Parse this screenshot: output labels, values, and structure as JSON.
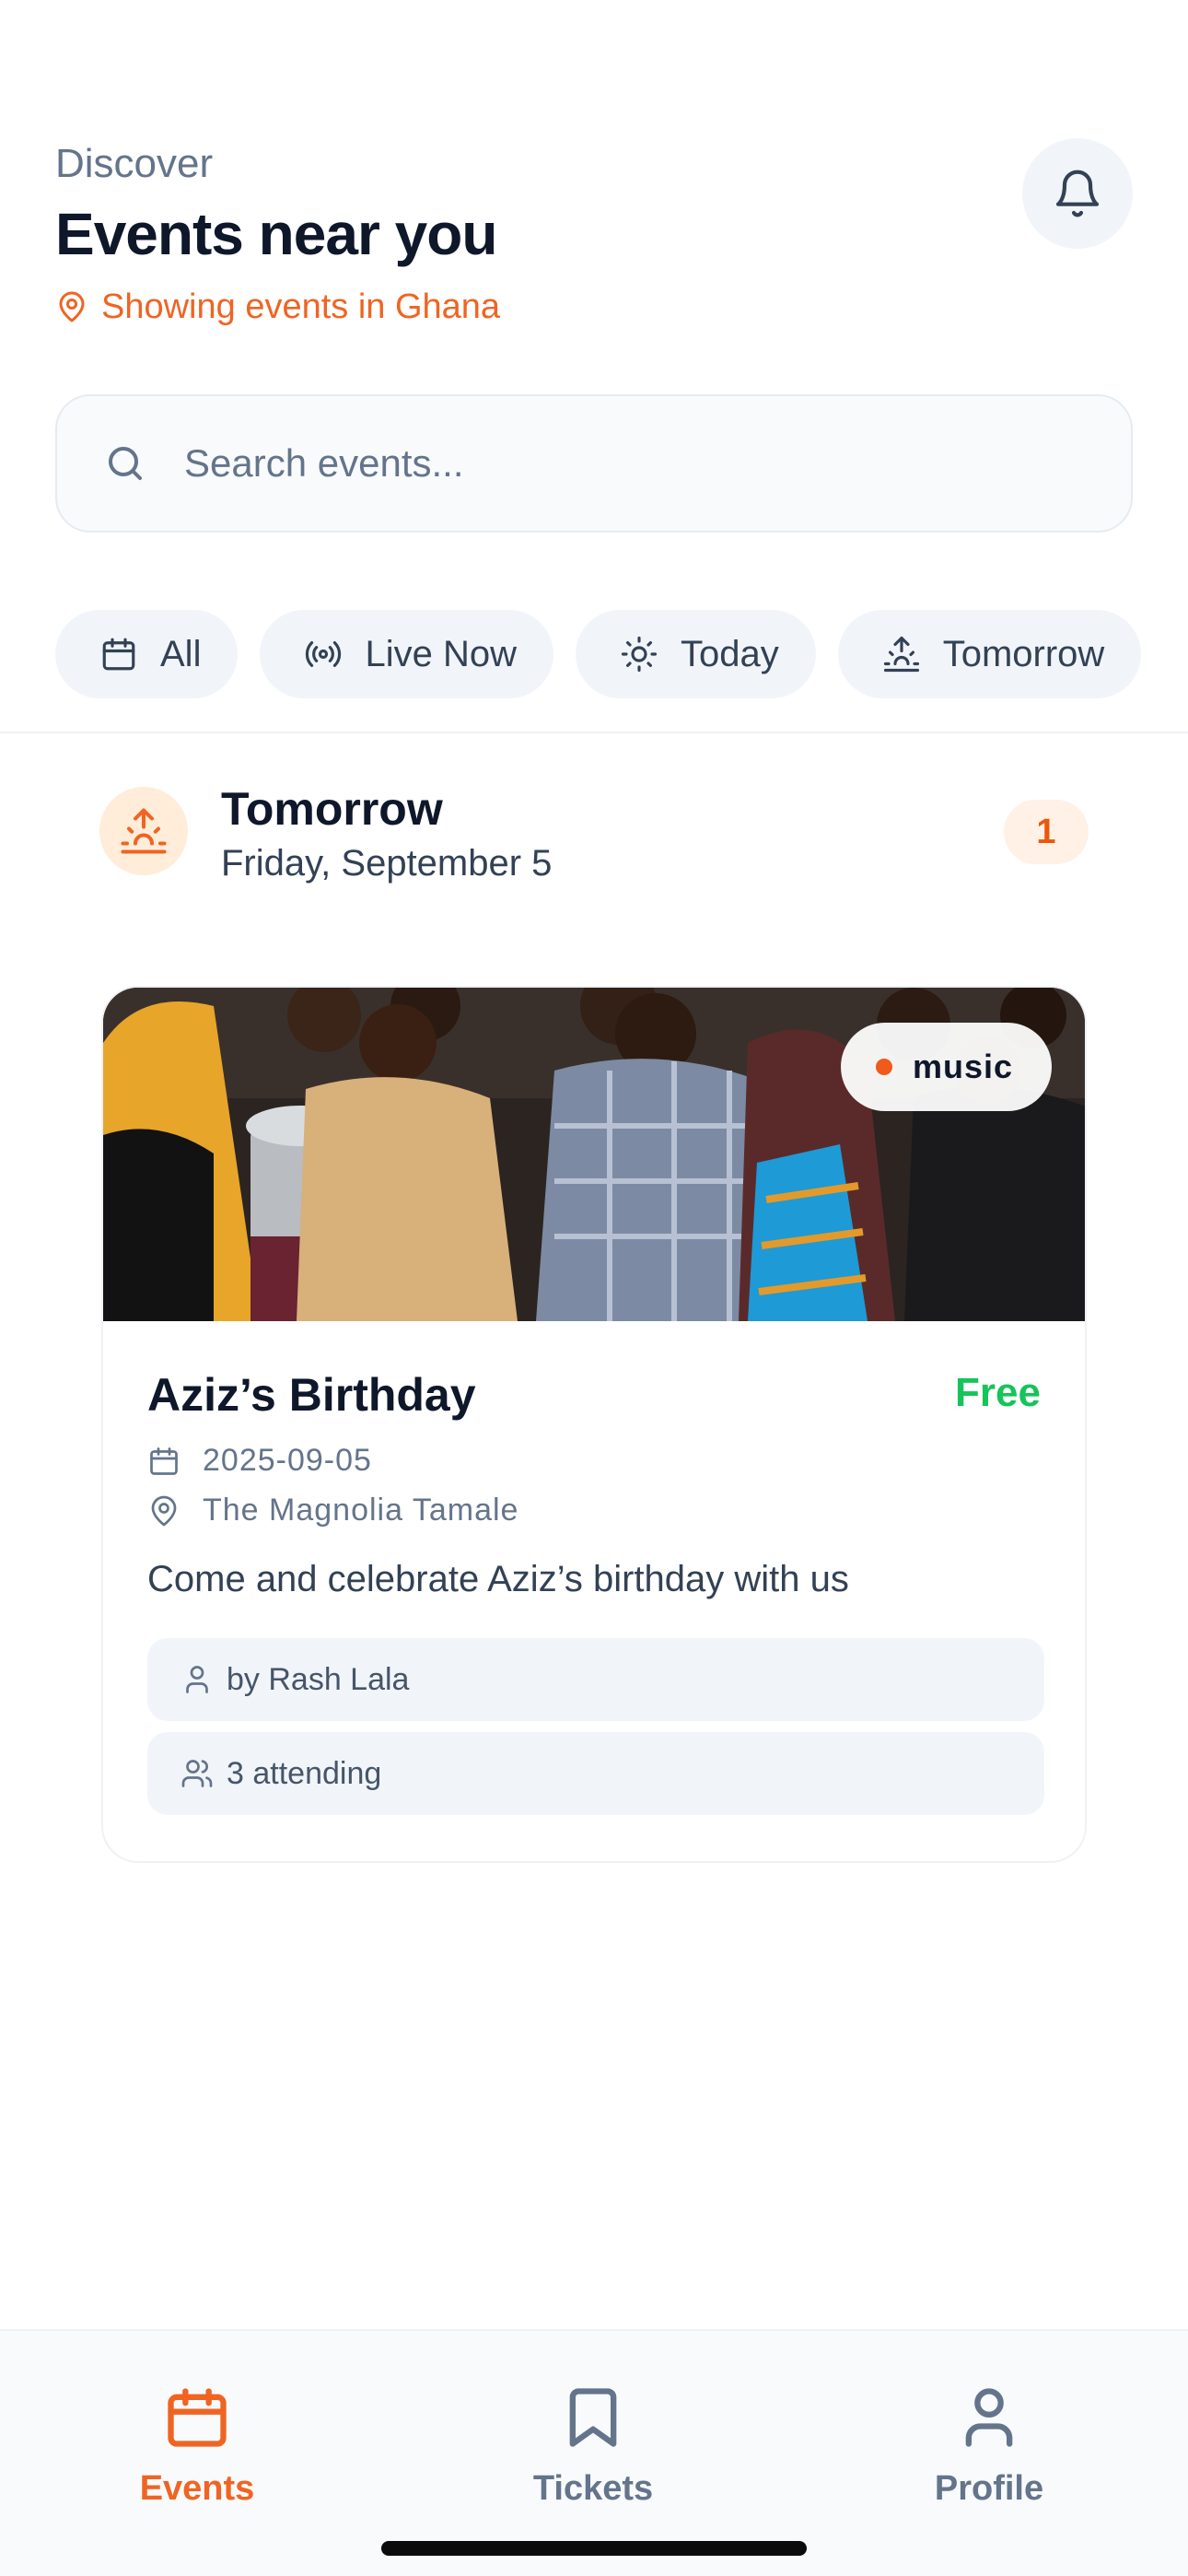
{
  "header": {
    "eyebrow": "Discover",
    "title": "Events near you",
    "location_text": "Showing events in Ghana"
  },
  "search": {
    "placeholder": "Search events..."
  },
  "filters": [
    {
      "label": "All",
      "icon": "calendar-icon"
    },
    {
      "label": "Live Now",
      "icon": "broadcast-icon"
    },
    {
      "label": "Today",
      "icon": "sun-icon"
    },
    {
      "label": "Tomorrow",
      "icon": "sunrise-icon"
    }
  ],
  "section": {
    "title": "Tomorrow",
    "subtitle": "Friday, September 5",
    "count": "1",
    "icon": "sunrise-icon"
  },
  "event": {
    "category": "music",
    "title": "Aziz’s Birthday",
    "price": "Free",
    "date": "2025-09-05",
    "venue": "The Magnolia Tamale",
    "description": "Come and celebrate Aziz’s birthday with us",
    "host": "by Rash Lala",
    "attending": "3 attending"
  },
  "tabbar": {
    "items": [
      {
        "label": "Events",
        "icon": "calendar-icon",
        "active": true
      },
      {
        "label": "Tickets",
        "icon": "bookmark-icon",
        "active": false
      },
      {
        "label": "Profile",
        "icon": "user-icon",
        "active": false
      }
    ]
  },
  "colors": {
    "accent": "#f06423",
    "price_green": "#16c45a",
    "chip_bg": "#f1f5f9",
    "text_dark": "#0f172a",
    "text_muted": "#64748b"
  }
}
